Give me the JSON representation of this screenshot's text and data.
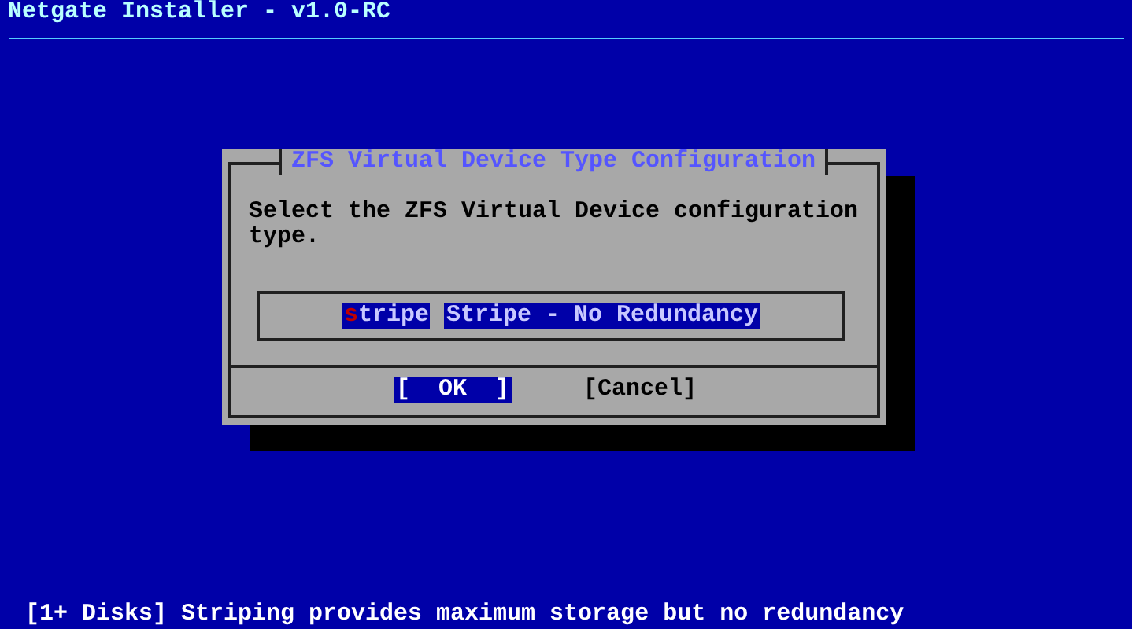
{
  "header": {
    "title": "Netgate Installer - v1.0-RC"
  },
  "dialog": {
    "title": "ZFS Virtual Device Type Configuration",
    "prompt": "Select the ZFS Virtual Device configuration type.",
    "items": [
      {
        "tag": "stripe",
        "description": "Stripe - No Redundancy",
        "selected": true
      }
    ],
    "buttons": [
      {
        "label": "[  OK  ]",
        "selected": true
      },
      {
        "label": "[Cancel]",
        "selected": false
      }
    ]
  },
  "status_bar": {
    "text": "[1+ Disks] Striping provides maximum storage but no redundancy"
  }
}
